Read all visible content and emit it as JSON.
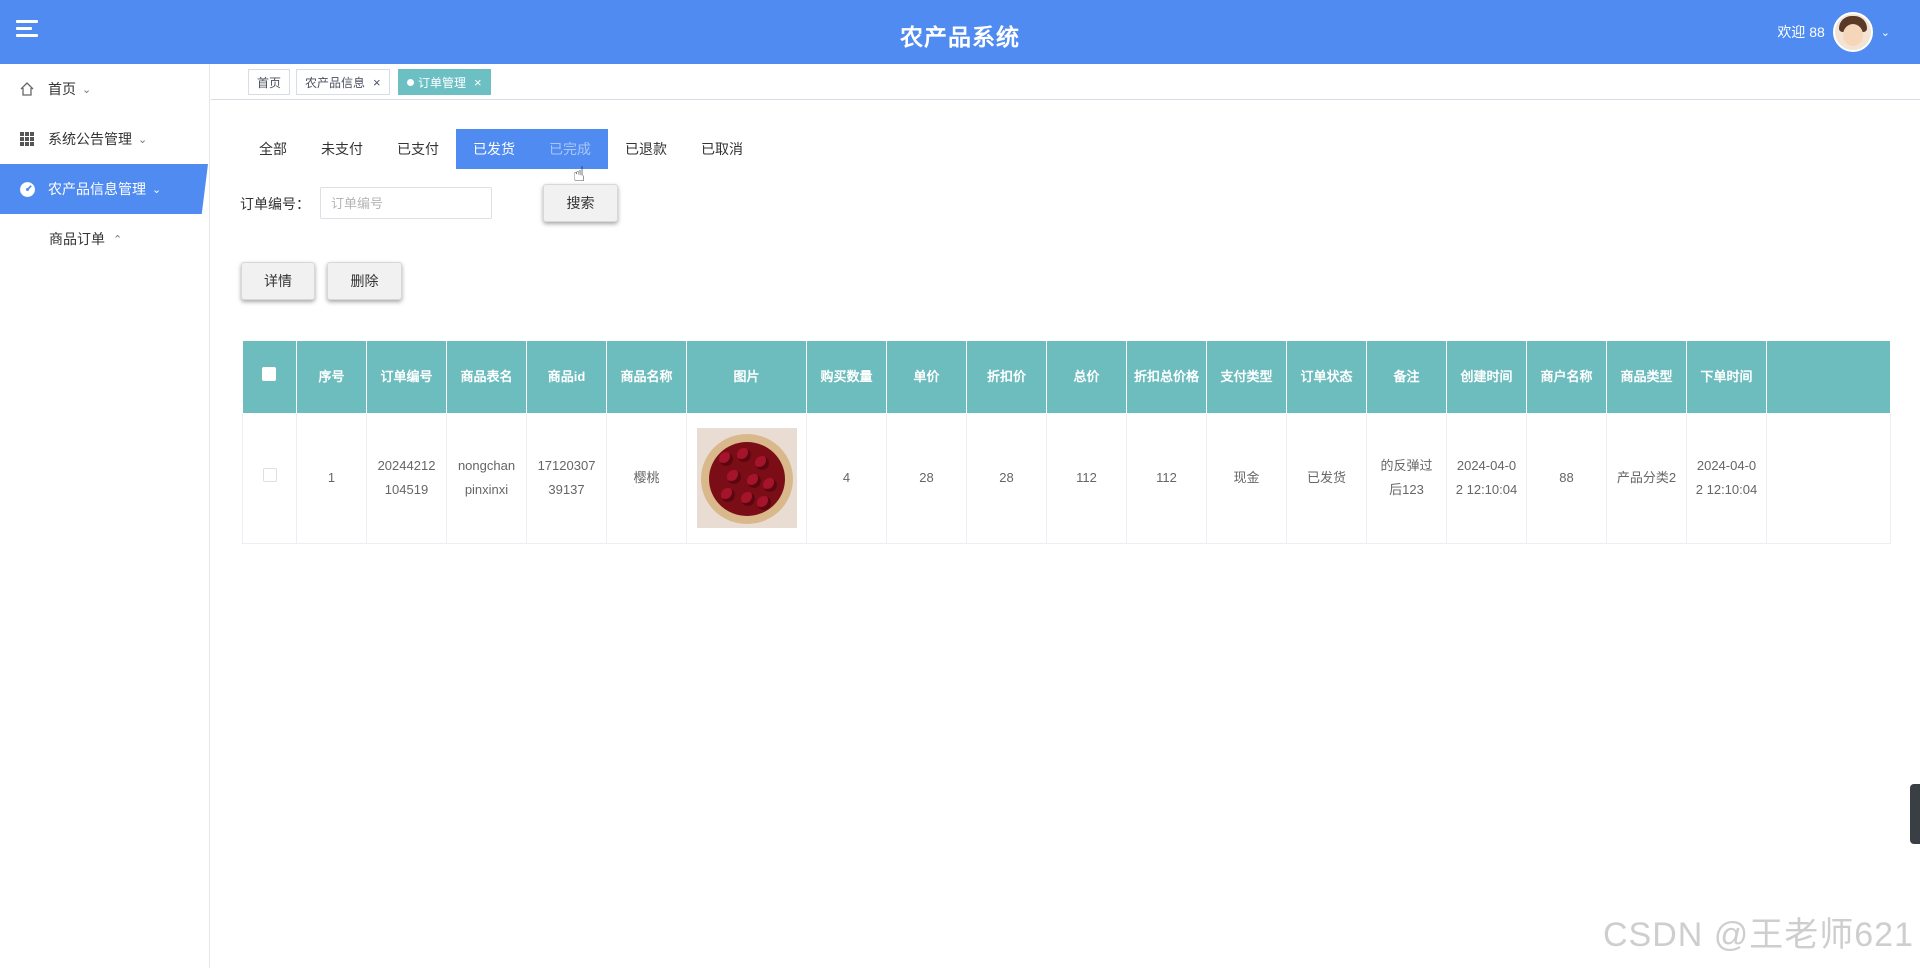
{
  "header": {
    "title": "农产品系统",
    "welcome": "欢迎 88"
  },
  "sidebar": {
    "items": [
      {
        "label": "首页",
        "icon": "home-icon"
      },
      {
        "label": "系统公告管理",
        "icon": "grid-icon"
      },
      {
        "label": "农产品信息管理",
        "icon": "gauge-icon"
      }
    ],
    "sub_items": [
      {
        "label": "商品订单"
      }
    ]
  },
  "tags": [
    {
      "label": "首页"
    },
    {
      "label": "农产品信息"
    },
    {
      "label": "订单管理"
    }
  ],
  "status_tabs": [
    "全部",
    "未支付",
    "已支付",
    "已发货",
    "已完成",
    "已退款",
    "已取消"
  ],
  "search": {
    "label": "订单编号：",
    "placeholder": "订单编号",
    "button": "搜索"
  },
  "actions": {
    "detail": "详情",
    "delete": "删除"
  },
  "table": {
    "columns": [
      "序号",
      "订单编号",
      "商品表名",
      "商品id",
      "商品名称",
      "图片",
      "购买数量",
      "单价",
      "折扣价",
      "总价",
      "折扣总价格",
      "支付类型",
      "订单状态",
      "备注",
      "创建时间",
      "商户名称",
      "商品类型",
      "下单时间"
    ],
    "rows": [
      [
        "1",
        "20244212104519",
        "nongchanpinxinxi",
        "1712030739137",
        "樱桃",
        "",
        "4",
        "28",
        "28",
        "112",
        "112",
        "现金",
        "已发货",
        "的反弹过后123",
        "2024-04-02 12:10:04",
        "88",
        "产品分类2",
        "2024-04-02 12:10:04"
      ]
    ]
  },
  "watermark": "CSDN @王老师621",
  "colors": {
    "primary": "#4f8bf0",
    "table_header": "#6ebdbe",
    "active_tag": "#6cc0c4"
  }
}
